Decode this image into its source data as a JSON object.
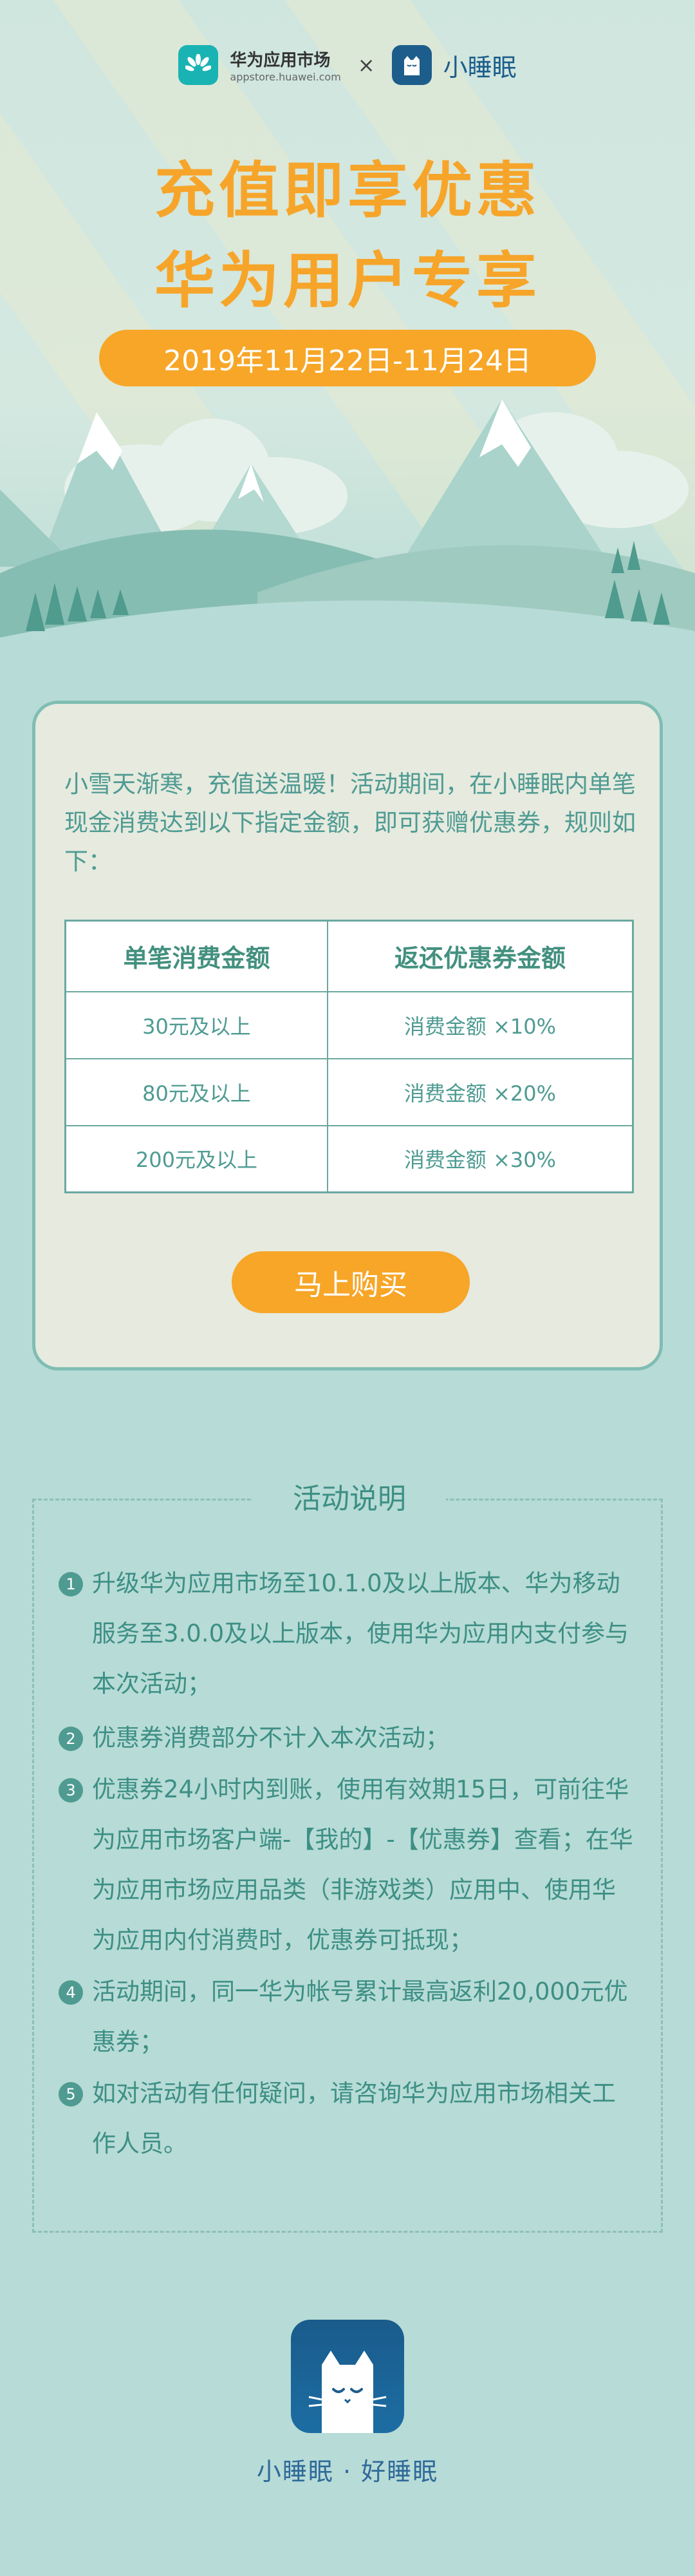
{
  "header": {
    "huawei_name": "华为应用市场",
    "huawei_url": "appstore.huawei.com",
    "times": "×",
    "app_name": "小睡眠"
  },
  "hero": {
    "title_line1": "充值即享优惠",
    "title_line2": "华为用户专享",
    "date": "2019年11月22日-11月24日"
  },
  "promo": {
    "intro": "小雪天渐寒，充值送温暖！活动期间，在小睡眠内单笔现金消费达到以下指定金额，即可获赠优惠券，规则如下：",
    "table": {
      "headers": [
        "单笔消费金额",
        "返还优惠券金额"
      ],
      "rows": [
        [
          "30元及以上",
          "消费金额 ×10%"
        ],
        [
          "80元及以上",
          "消费金额 ×20%"
        ],
        [
          "200元及以上",
          "消费金额 ×30%"
        ]
      ]
    },
    "buy_label": "马上购买"
  },
  "rules": {
    "title": "活动说明",
    "items": [
      {
        "num": "1",
        "text": "升级华为应用市场至10.1.0及以上版本、华为移动服务至3.0.0及以上版本，使用华为应用内支付参与本次活动；"
      },
      {
        "num": "2",
        "text": "优惠券消费部分不计入本次活动；"
      },
      {
        "num": "3",
        "text": "优惠券24小时内到账，使用有效期15日，可前往华为应用市场客户端-【我的】-【优惠券】查看；在华为应用市场应用品类（非游戏类）应用中、使用华为应用内付消费时，优惠券可抵现；"
      },
      {
        "num": "4",
        "text": "活动期间，同一华为帐号累计最高返利20,000元优惠券；"
      },
      {
        "num": "5",
        "text": "如对活动有任何疑问，请咨询华为应用市场相关工作人员。"
      }
    ]
  },
  "footer": {
    "slogan": "小睡眠 · 好睡眠"
  },
  "colors": {
    "accent_orange": "#f7a628",
    "teal_text": "#3d8f85",
    "page_bg": "#b7dbd6",
    "app_blue": "#1d5d8b"
  }
}
